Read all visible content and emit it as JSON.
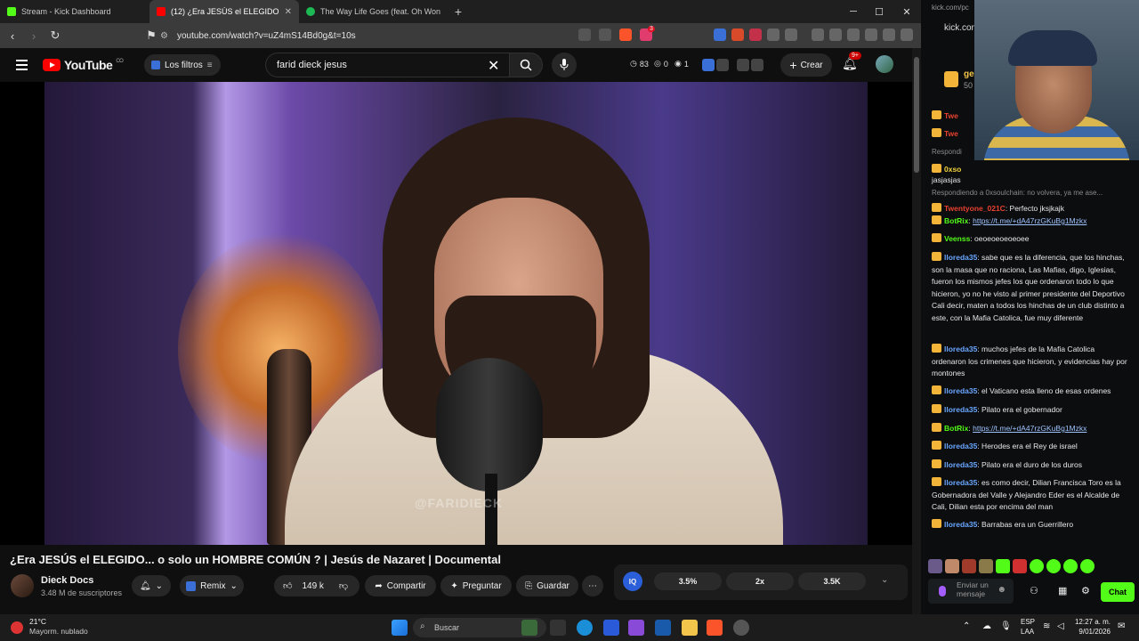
{
  "tabs": [
    {
      "title": "Stream - Kick Dashboard",
      "active": false
    },
    {
      "title": "(12) ¿Era JESÚS el ELEGIDO...",
      "active": true
    },
    {
      "title": "The Way Life Goes (feat. Oh Won",
      "active": false
    }
  ],
  "address_bar": {
    "url": "youtube.com/watch?v=uZ4mS14Bd0g&t=10s",
    "extension_badge": "3"
  },
  "youtube": {
    "logo_text": "YouTube",
    "logo_region": "CO",
    "filters_label": "Los filtros",
    "search_value": "farid dieck jesus",
    "stats": {
      "views": "83",
      "a": "0",
      "b": "1"
    },
    "create_label": "Crear",
    "notifications_badge": "9+",
    "video_watermark": "@FARIDIECK",
    "video_title": "¿Era JESÚS el ELEGIDO... o solo un HOMBRE COMÚN ? | Jesús de Nazaret | Documental",
    "channel_name": "Dieck Docs",
    "subscribers": "3.48 M de suscriptores",
    "remix_label": "Remix",
    "likes": "149 k",
    "share_label": "Compartir",
    "ask_label": "Preguntar",
    "save_label": "Guardar",
    "ext_values": [
      "3.5%",
      "2x",
      "3.5K"
    ]
  },
  "kick": {
    "url": "kick.com/pc",
    "url2": "kick.com",
    "header_name": "ge",
    "header_sub": "50",
    "messages": [
      {
        "user": "Twe",
        "text": "",
        "color": "#e8412f"
      },
      {
        "user": "Twe",
        "text": "",
        "color": "#e8412f"
      },
      {
        "reply": "Respondi"
      },
      {
        "user": "0xso",
        "text": "",
        "color": "#f1d23d"
      },
      {
        "plain": "jasjasjas"
      },
      {
        "reply": "Respondiendo a 0xsoulchain: no volvera, ya me ase..."
      },
      {
        "user": "Twentyone_021C",
        "text": ": Perfecto jksjkajk",
        "color": "#e8412f"
      },
      {
        "user": "BotRix",
        "text": ": ",
        "link": "https://t.me/+dA47rzGKuBg1Mzkx",
        "color": "#53fc18"
      },
      {
        "user": "Veenss",
        "text": ": oeoeoeoeoeoee",
        "color": "#53fc18"
      },
      {
        "user": "lloreda35",
        "text": ": sabe que es la diferencia, que los hinchas, son la masa que no raciona, Las Mafias, digo, Iglesias, fueron los mismos jefes los que ordenaron todo lo que hicieron, yo no he visto al primer presidente del Deportivo Cali decir, maten a todos los hinchas de un club distinto a este, con la Mafia Catolica, fue muy diferente",
        "color": "#6aa6ff"
      },
      {
        "user": "lloreda35",
        "text": ": muchos jefes de la Mafia Catolica ordenaron los crimenes que hicieron, y evidencias hay por montones",
        "color": "#6aa6ff"
      },
      {
        "user": "lloreda35",
        "text": ": el Vaticano esta lleno de esas ordenes",
        "color": "#6aa6ff"
      },
      {
        "user": "lloreda35",
        "text": ": Pilato era el gobernador",
        "color": "#6aa6ff"
      },
      {
        "user": "BotRix",
        "text": ": ",
        "link": "https://t.me/+dA47rzGKuBg1Mzkx",
        "color": "#53fc18"
      },
      {
        "user": "lloreda35",
        "text": ": Herodes era el Rey de israel",
        "color": "#6aa6ff"
      },
      {
        "user": "lloreda35",
        "text": ": Pilato era el duro de los duros",
        "color": "#6aa6ff"
      },
      {
        "user": "lloreda35",
        "text": ": es como decir, Dilian Francisca Toro es la Gobernadora del Valle y Alejandro Eder es el Alcalde de Cali, Dilian esta por encima del man",
        "color": "#6aa6ff"
      },
      {
        "user": "lloreda35",
        "text": ": Barrabas era un Guerrillero",
        "color": "#6aa6ff"
      }
    ],
    "chat_placeholder": "Enviar un mensaje",
    "chat_button": "Chat"
  },
  "taskbar": {
    "weather_temp": "21°C",
    "weather_desc": "Mayorm. nublado",
    "search_label": "Buscar",
    "lang1": "ESP",
    "lang2": "LAA",
    "time": "12:27 a. m.",
    "date": "9/01/2026"
  }
}
